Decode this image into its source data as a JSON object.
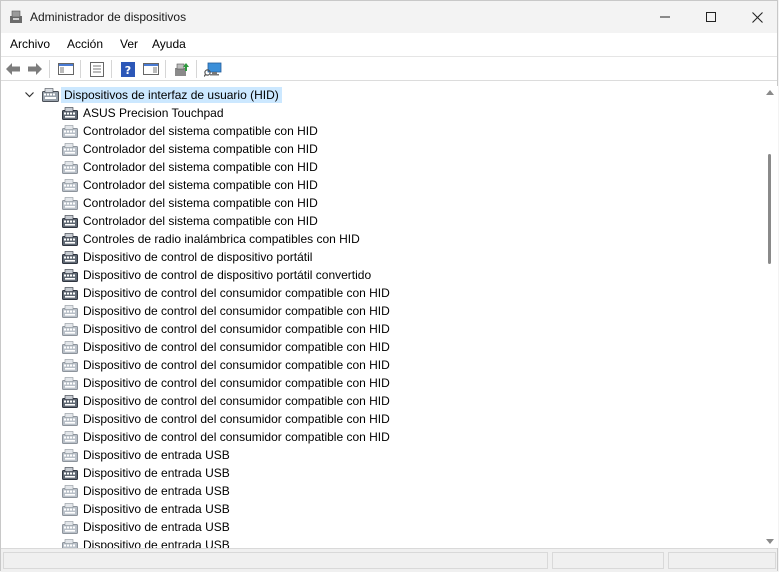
{
  "window": {
    "title": "Administrador de dispositivos"
  },
  "menu": [
    "Archivo",
    "Acción",
    "Ver",
    "Ayuda"
  ],
  "tree": {
    "category": "Dispositivos de interfaz de usuario (HID)",
    "devices": [
      {
        "label": "ASUS Precision Touchpad",
        "enabled": true
      },
      {
        "label": "Controlador del sistema compatible con HID",
        "enabled": false
      },
      {
        "label": "Controlador del sistema compatible con HID",
        "enabled": false
      },
      {
        "label": "Controlador del sistema compatible con HID",
        "enabled": false
      },
      {
        "label": "Controlador del sistema compatible con HID",
        "enabled": false
      },
      {
        "label": "Controlador del sistema compatible con HID",
        "enabled": false
      },
      {
        "label": "Controlador del sistema compatible con HID",
        "enabled": true
      },
      {
        "label": "Controles de radio inalámbrica compatibles con HID",
        "enabled": true
      },
      {
        "label": "Dispositivo de control de dispositivo portátil",
        "enabled": true
      },
      {
        "label": "Dispositivo de control de dispositivo portátil convertido",
        "enabled": true
      },
      {
        "label": "Dispositivo de control del consumidor compatible con HID",
        "enabled": true
      },
      {
        "label": "Dispositivo de control del consumidor compatible con HID",
        "enabled": false
      },
      {
        "label": "Dispositivo de control del consumidor compatible con HID",
        "enabled": false
      },
      {
        "label": "Dispositivo de control del consumidor compatible con HID",
        "enabled": false
      },
      {
        "label": "Dispositivo de control del consumidor compatible con HID",
        "enabled": false
      },
      {
        "label": "Dispositivo de control del consumidor compatible con HID",
        "enabled": false
      },
      {
        "label": "Dispositivo de control del consumidor compatible con HID",
        "enabled": true
      },
      {
        "label": "Dispositivo de control del consumidor compatible con HID",
        "enabled": false
      },
      {
        "label": "Dispositivo de control del consumidor compatible con HID",
        "enabled": false
      },
      {
        "label": "Dispositivo de entrada USB",
        "enabled": false
      },
      {
        "label": "Dispositivo de entrada USB",
        "enabled": true
      },
      {
        "label": "Dispositivo de entrada USB",
        "enabled": false
      },
      {
        "label": "Dispositivo de entrada USB",
        "enabled": false
      },
      {
        "label": "Dispositivo de entrada USB",
        "enabled": false
      },
      {
        "label": "Dispositivo de entrada USB",
        "enabled": false
      }
    ]
  },
  "toolbar_icons": [
    "back-arrow-icon",
    "forward-arrow-icon",
    "show-hide-console-tree-icon",
    "properties-icon",
    "help-icon",
    "action-pane-icon",
    "update-driver-icon",
    "scan-hardware-icon"
  ],
  "colors": {
    "selection": "#cce8ff",
    "titlebar": "#f3f3f3"
  }
}
